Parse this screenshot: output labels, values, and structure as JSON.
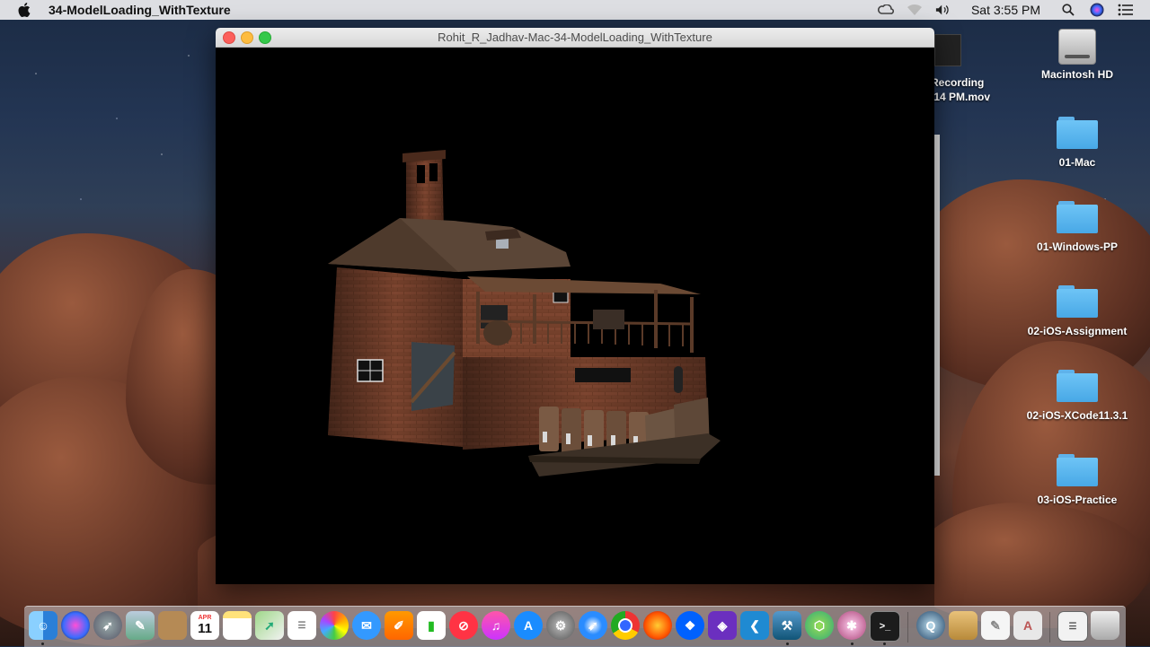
{
  "menubar": {
    "app_name": "34-ModelLoading_WithTexture",
    "clock": "Sat 3:55 PM",
    "icons": [
      "apple-icon",
      "creative-cloud-icon",
      "wifi-icon",
      "volume-icon",
      "spotlight-search-icon",
      "siri-icon",
      "notification-center-icon"
    ]
  },
  "window": {
    "title": "Rohit_R_Jadhav-Mac-34-ModelLoading_WithTexture",
    "content": "3d-textured-house-model"
  },
  "background_video": {
    "label_line1": "Recording",
    "label_line2": ".14 PM.mov"
  },
  "desktop_icons": [
    {
      "label": "Macintosh HD",
      "icon": "hard-drive-icon"
    },
    {
      "label": "01-Mac",
      "icon": "folder-icon"
    },
    {
      "label": "01-Windows-PP",
      "icon": "folder-icon"
    },
    {
      "label": "02-iOS-Assignment",
      "icon": "folder-icon"
    },
    {
      "label": "02-iOS-XCode11.3.1",
      "icon": "folder-icon"
    },
    {
      "label": "03-iOS-Practice",
      "icon": "folder-icon"
    }
  ],
  "dock": {
    "calendar_month": "APR",
    "calendar_day": "11",
    "apps": [
      "Finder",
      "Siri",
      "Launchpad",
      "Preview",
      "Contacts",
      "Calendar",
      "Notes",
      "Maps",
      "Reminders",
      "Photos",
      "Messages",
      "Pages",
      "Numbers",
      "News",
      "Music",
      "App Store",
      "System Preferences",
      "Safari",
      "Chrome",
      "Firefox",
      "Dropbox",
      "Visual Studio",
      "VS Code",
      "Xcode",
      "Android Studio",
      "Instruments",
      "Terminal",
      "QuickTime",
      "Archive Utility",
      "TextEdit",
      "Documents",
      "Trash"
    ]
  },
  "colors": {
    "close": "#fc605c",
    "minimize": "#fdbc40",
    "zoom": "#34c84a",
    "folder": "#5cb8f0"
  }
}
